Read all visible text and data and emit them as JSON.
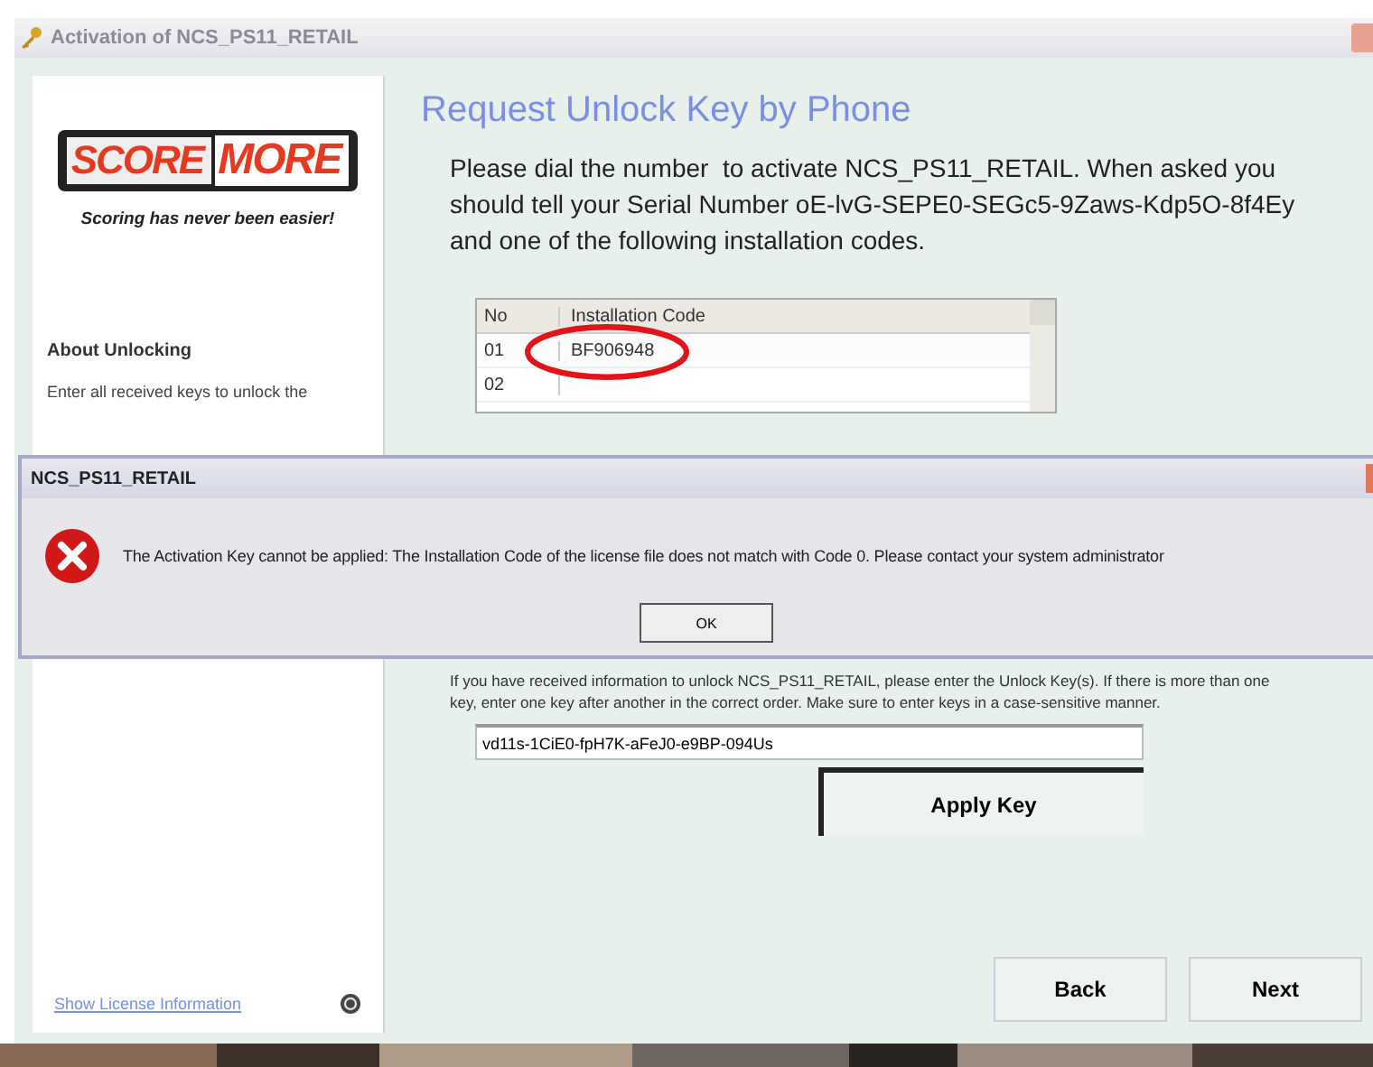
{
  "window": {
    "title": "Activation of NCS_PS11_RETAIL"
  },
  "sidebar": {
    "logo": [
      "SCORE",
      "MORE"
    ],
    "tagline": "Scoring has never been easier!",
    "about_heading": "About Unlocking",
    "about_text": "Enter all received keys to unlock the",
    "link": "Show License Information"
  },
  "page": {
    "heading": "Request Unlock Key by Phone",
    "intro": "Please dial the number  to activate NCS_PS11_RETAIL. When asked you should tell your Serial Number oE-lvG-SEPE0-SEGc5-9Zaws-Kdp5O-8f4Ey and one of the following installation codes.",
    "table": {
      "columns": [
        "No",
        "Installation Code"
      ],
      "rows": [
        {
          "no": "01",
          "code": "BF906948",
          "highlighted": true
        },
        {
          "no": "02",
          "highlighted": false
        }
      ]
    },
    "instructions": "If you have received information to unlock NCS_PS11_RETAIL, please enter the Unlock Key(s). If there is more than one key, enter one key after another in the correct order. Make sure to enter keys in a case-sensitive manner.",
    "unlock_key": "vd11s-1CiE0-fpH7K-aFeJ0-e9BP-094Us",
    "apply_button": "Apply Key"
  },
  "buttons": [
    "Back",
    "Next"
  ],
  "dialog": {
    "title": "NCS_PS11_RETAIL",
    "message": "The Activation Key cannot be applied: The Installation Code of the license file does not match with Code 0. Please contact your system administrator",
    "button": "OK"
  }
}
